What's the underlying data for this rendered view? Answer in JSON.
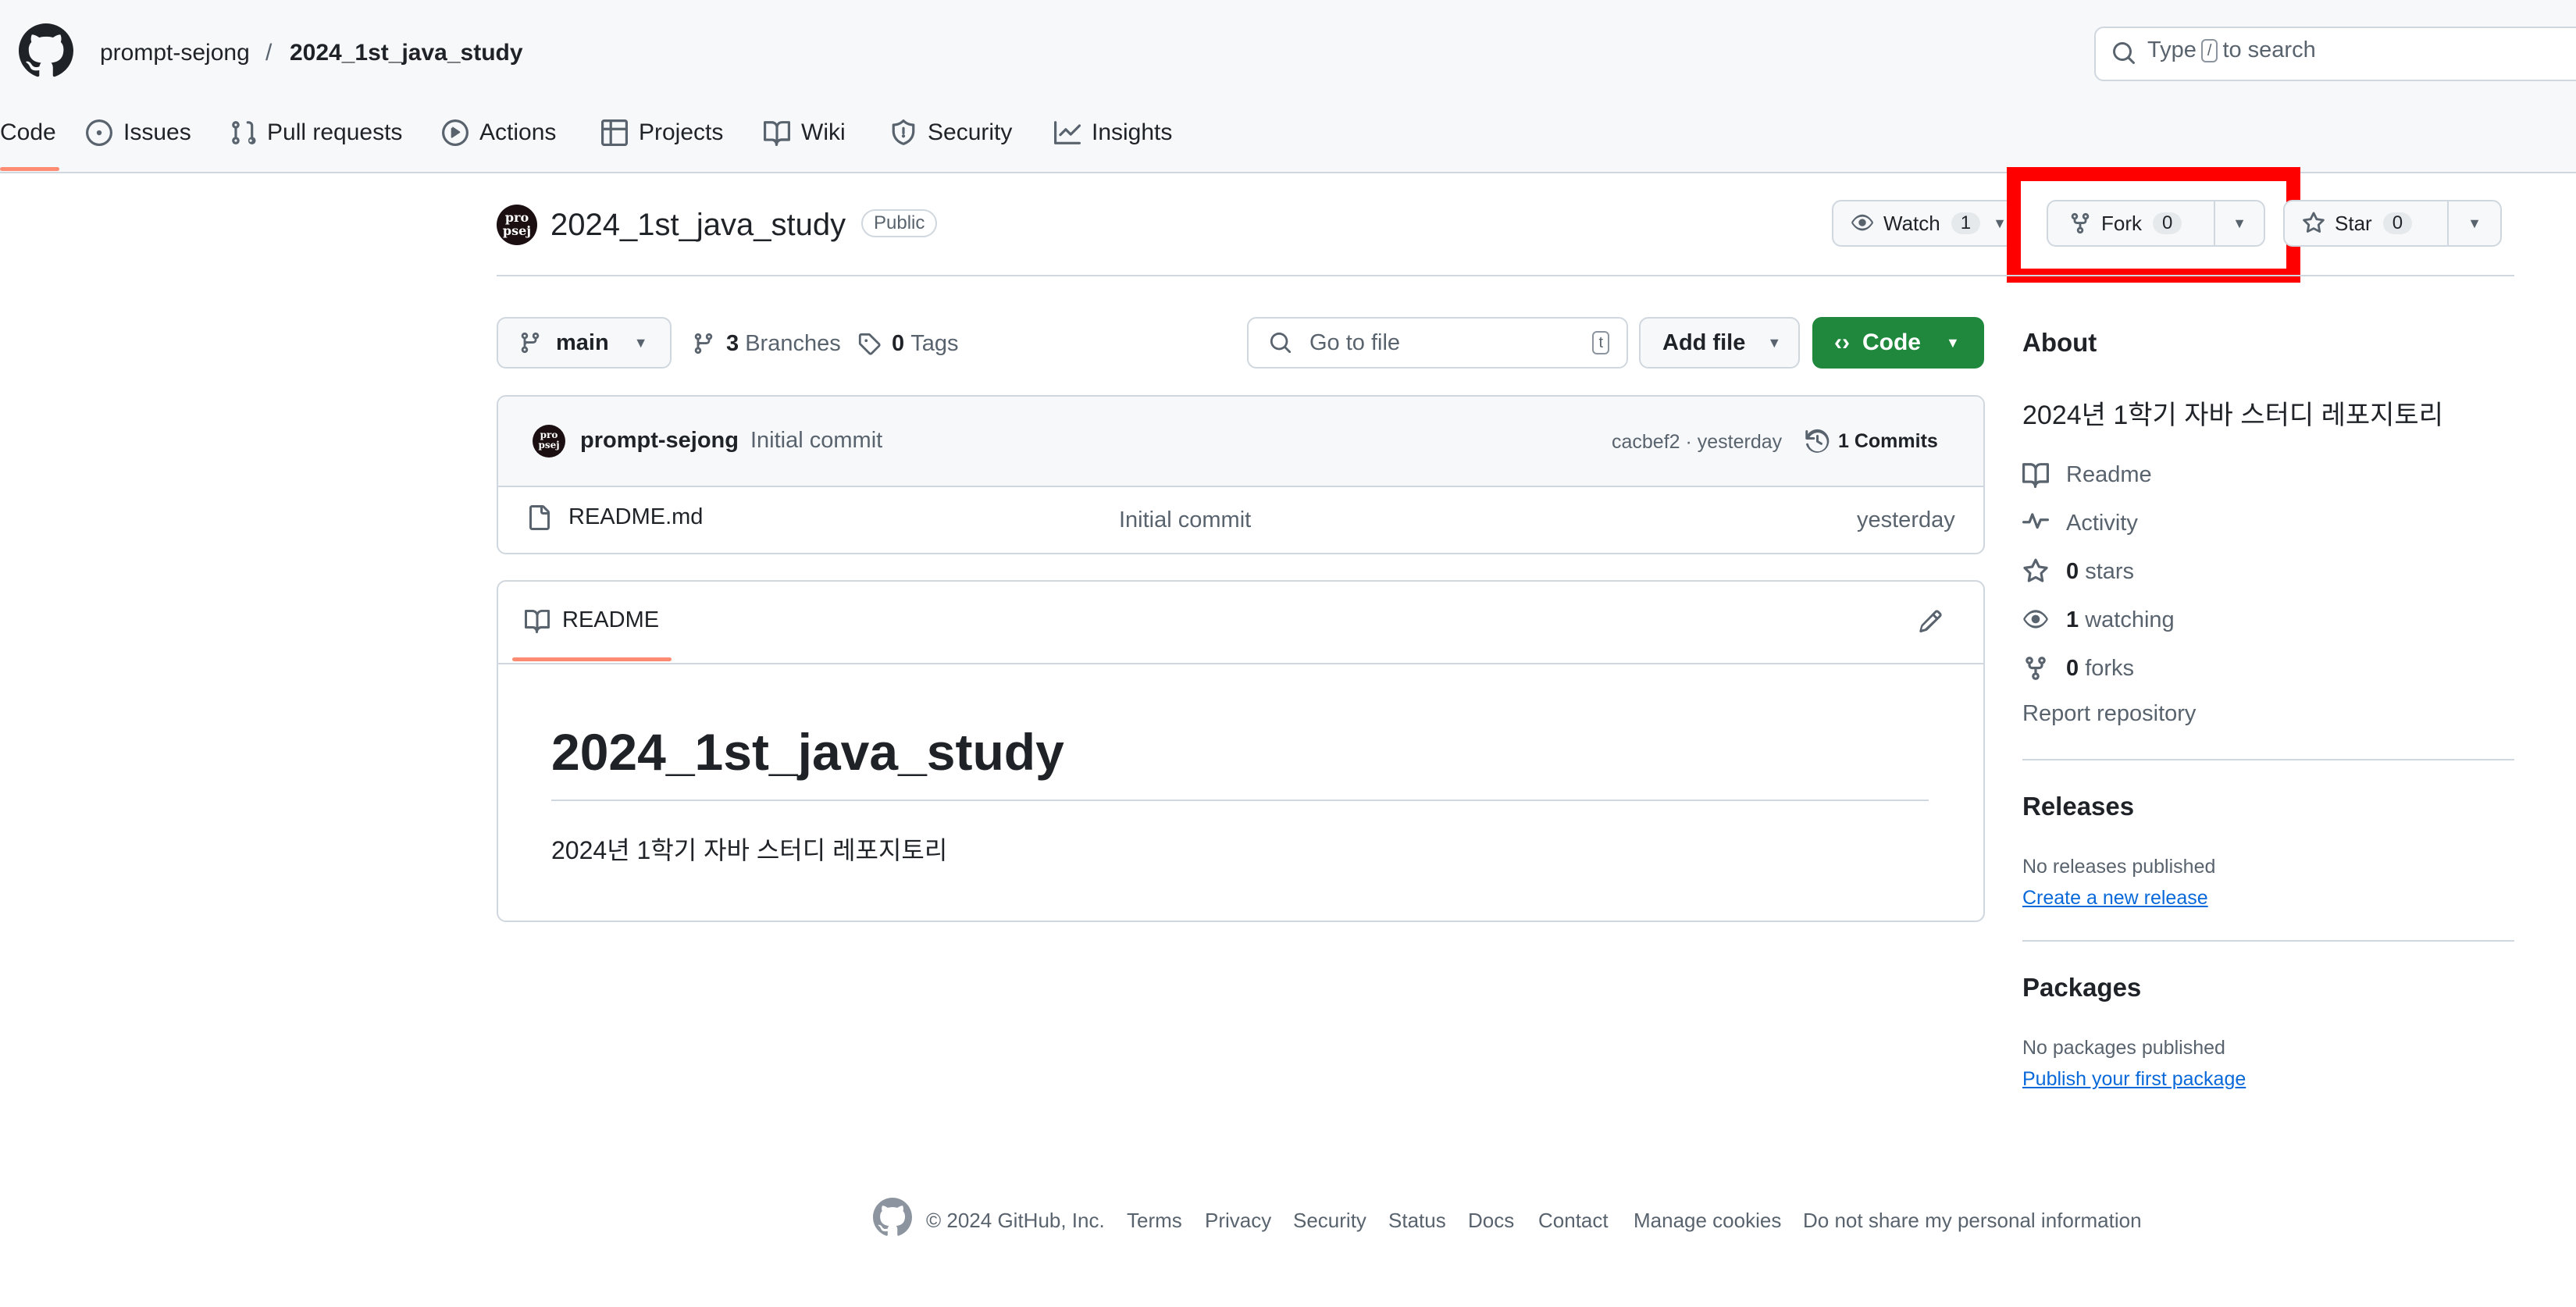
{
  "header": {
    "owner": "prompt-sejong",
    "separator": "/",
    "repo": "2024_1st_java_study",
    "search_pre": "Type",
    "search_key": "/",
    "search_post": "to search"
  },
  "tabs": [
    {
      "label": "Code"
    },
    {
      "label": "Issues"
    },
    {
      "label": "Pull requests"
    },
    {
      "label": "Actions"
    },
    {
      "label": "Projects"
    },
    {
      "label": "Wiki"
    },
    {
      "label": "Security"
    },
    {
      "label": "Insights"
    }
  ],
  "repo": {
    "title": "2024_1st_java_study",
    "visibility": "Public",
    "avatar_text": "pro\npsej",
    "watch_label": "Watch",
    "watch_count": "1",
    "fork_label": "Fork",
    "fork_count": "0",
    "star_label": "Star",
    "star_count": "0"
  },
  "toolbar": {
    "branch": "main",
    "branches_count": "3",
    "branches_label": "Branches",
    "tags_count": "0",
    "tags_label": "Tags",
    "goto_placeholder": "Go to file",
    "goto_key": "t",
    "add_file": "Add file",
    "code": "Code"
  },
  "commit": {
    "author": "prompt-sejong",
    "message": "Initial commit",
    "hash_time": "cacbef2 · yesterday",
    "commits": "1 Commits"
  },
  "files": [
    {
      "name": "README.md",
      "message": "Initial commit",
      "time": "yesterday"
    }
  ],
  "readme": {
    "tab": "README",
    "heading": "2024_1st_java_study",
    "body": "2024년 1학기 자바 스터디 레포지토리"
  },
  "about": {
    "title": "About",
    "description": "2024년 1학기 자바 스터디 레포지토리",
    "readme": "Readme",
    "activity": "Activity",
    "stars_count": "0",
    "stars_label": "stars",
    "watching_count": "1",
    "watching_label": "watching",
    "forks_count": "0",
    "forks_label": "forks",
    "report": "Report repository"
  },
  "releases": {
    "title": "Releases",
    "none": "No releases published",
    "create": "Create a new release"
  },
  "packages": {
    "title": "Packages",
    "none": "No packages published",
    "publish": "Publish your first package"
  },
  "footer": {
    "copyright": "© 2024 GitHub, Inc.",
    "links": [
      "Terms",
      "Privacy",
      "Security",
      "Status",
      "Docs",
      "Contact",
      "Manage cookies",
      "Do not share my personal information"
    ]
  },
  "colors": {
    "accent_green": "#1f883d",
    "highlight_red": "#ff0000",
    "tab_underline": "#fd8c73",
    "link_blue": "#0969da"
  }
}
